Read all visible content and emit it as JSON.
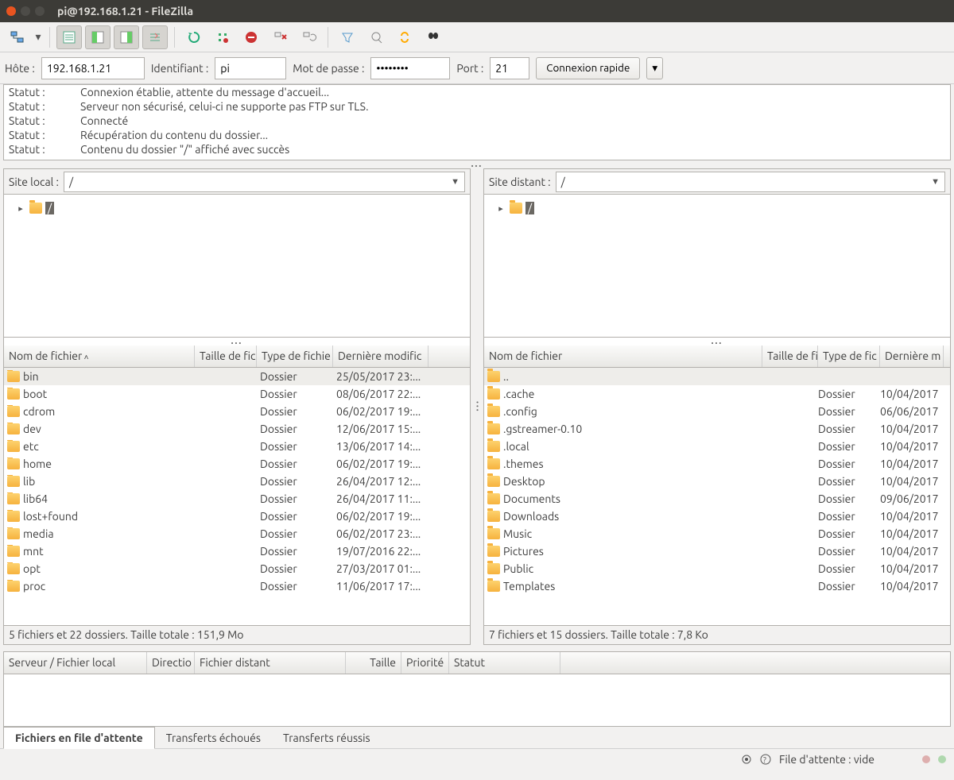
{
  "window": {
    "title": "pi@192.168.1.21 - FileZilla"
  },
  "quickbar": {
    "host_label": "Hôte :",
    "host_value": "192.168.1.21",
    "user_label": "Identifiant :",
    "user_value": "pi",
    "pass_label": "Mot de passe :",
    "pass_value": "••••••••",
    "port_label": "Port :",
    "port_value": "21",
    "connect_label": "Connexion rapide"
  },
  "log": [
    {
      "label": "Statut :",
      "msg": "Connexion établie, attente du message d'accueil..."
    },
    {
      "label": "Statut :",
      "msg": "Serveur non sécurisé, celui-ci ne supporte pas FTP sur TLS."
    },
    {
      "label": "Statut :",
      "msg": "Connecté"
    },
    {
      "label": "Statut :",
      "msg": "Récupération du contenu du dossier..."
    },
    {
      "label": "Statut :",
      "msg": "Contenu du dossier \"/\" affiché avec succès"
    }
  ],
  "local": {
    "label": "Site local :",
    "path": "/",
    "tree_root": "/",
    "columns": {
      "name": "Nom de fichier",
      "size": "Taille de fic",
      "type": "Type de fichie",
      "date": "Dernière modific"
    },
    "rows": [
      {
        "name": "bin",
        "type": "Dossier",
        "date": "25/05/2017 23:..."
      },
      {
        "name": "boot",
        "type": "Dossier",
        "date": "08/06/2017 22:..."
      },
      {
        "name": "cdrom",
        "type": "Dossier",
        "date": "06/02/2017 19:..."
      },
      {
        "name": "dev",
        "type": "Dossier",
        "date": "12/06/2017 15:..."
      },
      {
        "name": "etc",
        "type": "Dossier",
        "date": "13/06/2017 14:..."
      },
      {
        "name": "home",
        "type": "Dossier",
        "date": "06/02/2017 19:..."
      },
      {
        "name": "lib",
        "type": "Dossier",
        "date": "26/04/2017 12:..."
      },
      {
        "name": "lib64",
        "type": "Dossier",
        "date": "26/04/2017 11:..."
      },
      {
        "name": "lost+found",
        "type": "Dossier",
        "date": "06/02/2017 19:..."
      },
      {
        "name": "media",
        "type": "Dossier",
        "date": "06/02/2017 23:..."
      },
      {
        "name": "mnt",
        "type": "Dossier",
        "date": "19/07/2016 22:..."
      },
      {
        "name": "opt",
        "type": "Dossier",
        "date": "27/03/2017 01:..."
      },
      {
        "name": "proc",
        "type": "Dossier",
        "date": "11/06/2017 17:..."
      }
    ],
    "status": "5 fichiers et 22 dossiers. Taille totale : 151,9 Mo"
  },
  "remote": {
    "label": "Site distant :",
    "path": "/",
    "tree_root": "/",
    "columns": {
      "name": "Nom de fichier",
      "size": "Taille de fi",
      "type": "Type de fic",
      "date": "Dernière m"
    },
    "rows": [
      {
        "name": "..",
        "type": "",
        "date": ""
      },
      {
        "name": ".cache",
        "type": "Dossier",
        "date": "10/04/2017"
      },
      {
        "name": ".config",
        "type": "Dossier",
        "date": "06/06/2017"
      },
      {
        "name": ".gstreamer-0.10",
        "type": "Dossier",
        "date": "10/04/2017"
      },
      {
        "name": ".local",
        "type": "Dossier",
        "date": "10/04/2017"
      },
      {
        "name": ".themes",
        "type": "Dossier",
        "date": "10/04/2017"
      },
      {
        "name": "Desktop",
        "type": "Dossier",
        "date": "10/04/2017"
      },
      {
        "name": "Documents",
        "type": "Dossier",
        "date": "09/06/2017"
      },
      {
        "name": "Downloads",
        "type": "Dossier",
        "date": "10/04/2017"
      },
      {
        "name": "Music",
        "type": "Dossier",
        "date": "10/04/2017"
      },
      {
        "name": "Pictures",
        "type": "Dossier",
        "date": "10/04/2017"
      },
      {
        "name": "Public",
        "type": "Dossier",
        "date": "10/04/2017"
      },
      {
        "name": "Templates",
        "type": "Dossier",
        "date": "10/04/2017"
      }
    ],
    "status": "7 fichiers et 15 dossiers. Taille totale : 7,8 Ko"
  },
  "queue": {
    "columns": {
      "server": "Serveur / Fichier local",
      "dir": "Directio",
      "remote": "Fichier distant",
      "size": "Taille",
      "prio": "Priorité",
      "status": "Statut"
    },
    "tabs": {
      "queued": "Fichiers en file d'attente",
      "failed": "Transferts échoués",
      "ok": "Transferts réussis"
    }
  },
  "statusbar": {
    "queue": "File d'attente : vide"
  }
}
